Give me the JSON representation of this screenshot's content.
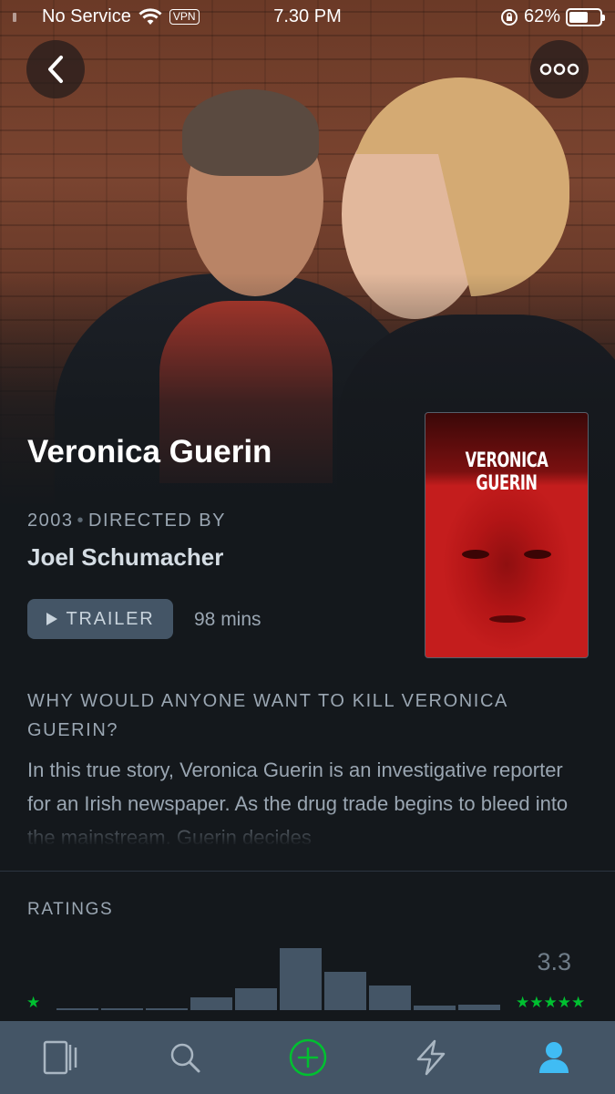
{
  "status_bar": {
    "carrier": "No Service",
    "vpn": "VPN",
    "time": "7.30 PM",
    "battery": "62%",
    "battery_level": 0.62
  },
  "film": {
    "title": "Veronica Guerin",
    "year": "2003",
    "directed_by_label": "DIRECTED BY",
    "director": "Joel Schumacher",
    "trailer_label": "TRAILER",
    "runtime": "98 mins",
    "poster_title": "VERONICA GUERIN",
    "tagline": "WHY WOULD ANYONE WANT TO KILL VERONICA GUERIN?",
    "synopsis": "In this true story, Veronica Guerin is an investigative reporter for an Irish newspaper. As the drug trade begins to bleed into the mainstream, Guerin decides"
  },
  "ratings": {
    "label": "RATINGS",
    "average": "3.3",
    "low_star": "★",
    "high_stars": "★★★★★",
    "histogram": [
      0.02,
      0.02,
      0.02,
      0.2,
      0.34,
      0.95,
      0.58,
      0.37,
      0.07,
      0.09
    ]
  },
  "colors": {
    "accent_green": "#00c030",
    "bar": "#445566",
    "background": "#14181c"
  },
  "icons": {
    "back": "chevron-left-icon",
    "more": "more-dots-icon",
    "tabs": [
      "films-icon",
      "search-icon",
      "add-icon",
      "activity-icon",
      "profile-icon"
    ]
  }
}
